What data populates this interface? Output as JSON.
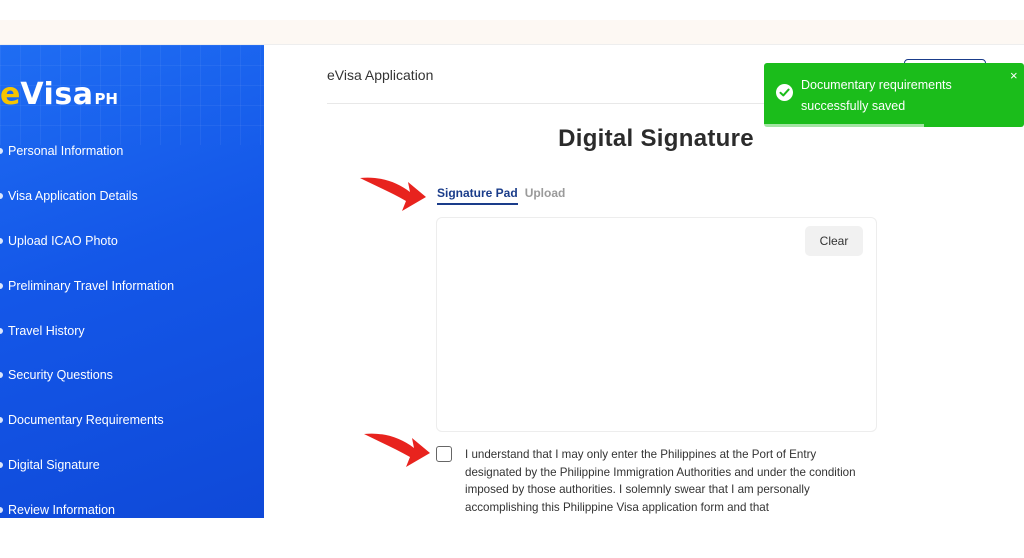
{
  "app": {
    "logo_e": "e",
    "logo_visa": "Visa",
    "logo_ph": "PH",
    "title": "eVisa Application"
  },
  "sidebar": {
    "items": [
      {
        "label": "Personal Information"
      },
      {
        "label": "Visa Application Details"
      },
      {
        "label": "Upload ICAO Photo"
      },
      {
        "label": "Preliminary Travel Information"
      },
      {
        "label": "Travel History"
      },
      {
        "label": "Security Questions"
      },
      {
        "label": "Documentary Requirements"
      },
      {
        "label": "Digital Signature"
      },
      {
        "label": "Review Information"
      }
    ]
  },
  "page": {
    "title": "Digital Signature",
    "tabs": [
      {
        "label": "Signature Pad",
        "active": true
      },
      {
        "label": "Upload",
        "active": false
      }
    ],
    "clear_label": "Clear",
    "agreement": {
      "checked": false,
      "text": "I understand that I may only enter the Philippines at the Port of Entry designated by the Philippine Immigration Authorities and under the condition imposed by those authorities. I solemnly swear that I am personally accomplishing this Philippine Visa application form and that"
    }
  },
  "toast": {
    "message": "Documentary requirements successfully saved",
    "close": "×",
    "icon": "check-circle-icon",
    "color": "#1bbd1b"
  },
  "colors": {
    "sidebar": "#1457e8",
    "accent": "#1a3c8a",
    "logo_e": "#f5c400",
    "arrow": "#e8231e"
  }
}
